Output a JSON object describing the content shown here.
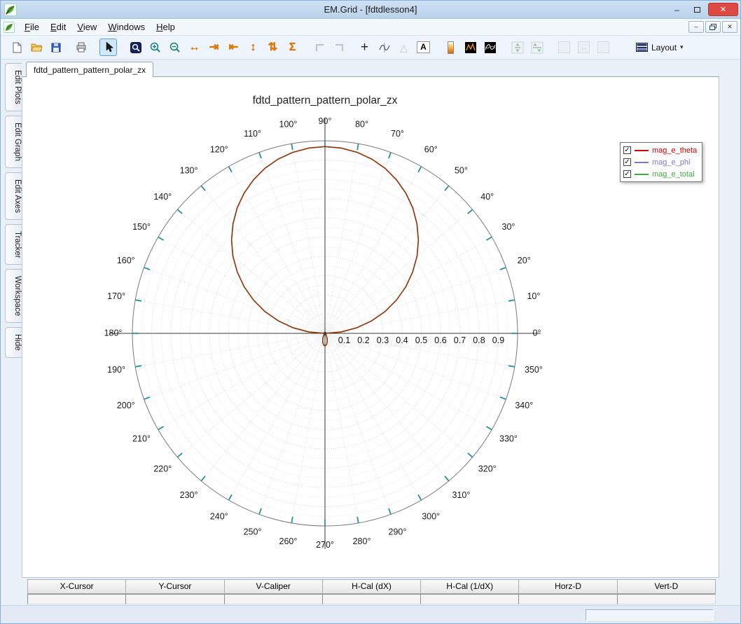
{
  "window": {
    "title": "EM.Grid - [fdtdlesson4]",
    "controls": {
      "minimize_glyph": "–",
      "close_glyph": "✕"
    }
  },
  "menu": {
    "items": [
      {
        "label": "File"
      },
      {
        "label": "Edit"
      },
      {
        "label": "View"
      },
      {
        "label": "Windows"
      },
      {
        "label": "Help"
      }
    ]
  },
  "toolbar": {
    "layout_label": "Layout",
    "glyphs": {
      "fit_h": "↔",
      "shift_r": "⇥",
      "shift_l": "⇤",
      "fit_v": "↕",
      "swap_v": "⇅",
      "autoscale": "Σ",
      "crosshair": "+",
      "triangle": "△",
      "text_tool": "A",
      "pane_h": "↔",
      "layout_caret": "▾"
    },
    "icons": [
      "new-file",
      "open-folder",
      "save",
      "print",
      "pointer",
      "zoom-region",
      "zoom-in",
      "zoom-out",
      "fit-horizontal",
      "shift-right",
      "shift-left",
      "fit-vertical",
      "swap-vertical",
      "autoscale-sum",
      "caliper-left",
      "caliper-right",
      "crosshair",
      "tracker-curve",
      "triangle-marker",
      "text-annotation",
      "colorbar",
      "spectrum-black-orange",
      "curves-black-white",
      "link-vertical-a",
      "link-vertical-b",
      "pane-a",
      "pane-horizontal",
      "pane-b",
      "layout-menu"
    ]
  },
  "sidebar": {
    "items": [
      {
        "label": "Edit Plots"
      },
      {
        "label": "Edit Graph"
      },
      {
        "label": "Edit Axes"
      },
      {
        "label": "Tracker"
      },
      {
        "label": "Workspace"
      },
      {
        "label": "Hide"
      }
    ]
  },
  "tabs": [
    {
      "label": "fdtd_pattern_pattern_polar_zx",
      "active": true
    }
  ],
  "chart_data": {
    "type": "polar",
    "title": "fdtd_pattern_pattern_polar_zx",
    "angle_unit": "deg",
    "angle_tick_step_deg": 10,
    "angle_label_suffix": "°",
    "angle_range": [
      0,
      360
    ],
    "r_axis": {
      "min": 0,
      "max": 1,
      "tick_step": 0.1,
      "grid_step": 0.05,
      "tick_labels": [
        "0.1",
        "0.2",
        "0.3",
        "0.4",
        "0.5",
        "0.6",
        "0.7",
        "0.8",
        "0.9"
      ]
    },
    "grid": true,
    "legend": {
      "position": "top-right",
      "check_glyph": "✓"
    },
    "series": [
      {
        "name": "mag_e_theta",
        "color": "#cc0000",
        "plot_color": "#8e3a10",
        "checked": true,
        "points": [
          [
            0,
            0
          ],
          [
            5,
            0.085
          ],
          [
            10,
            0.168
          ],
          [
            15,
            0.251
          ],
          [
            20,
            0.332
          ],
          [
            25,
            0.41
          ],
          [
            30,
            0.485
          ],
          [
            35,
            0.556
          ],
          [
            40,
            0.624
          ],
          [
            45,
            0.686
          ],
          [
            50,
            0.743
          ],
          [
            55,
            0.795
          ],
          [
            60,
            0.84
          ],
          [
            65,
            0.879
          ],
          [
            70,
            0.912
          ],
          [
            75,
            0.937
          ],
          [
            80,
            0.955
          ],
          [
            85,
            0.966
          ],
          [
            90,
            0.97
          ],
          [
            95,
            0.966
          ],
          [
            100,
            0.955
          ],
          [
            105,
            0.937
          ],
          [
            110,
            0.912
          ],
          [
            115,
            0.879
          ],
          [
            120,
            0.84
          ],
          [
            125,
            0.795
          ],
          [
            130,
            0.743
          ],
          [
            135,
            0.686
          ],
          [
            140,
            0.624
          ],
          [
            145,
            0.556
          ],
          [
            150,
            0.485
          ],
          [
            155,
            0.41
          ],
          [
            160,
            0.332
          ],
          [
            165,
            0.251
          ],
          [
            170,
            0.168
          ],
          [
            175,
            0.085
          ],
          [
            180,
            0
          ],
          [
            185,
            0.001
          ],
          [
            190,
            0.001
          ],
          [
            195,
            0.001
          ],
          [
            200,
            0.001
          ],
          [
            205,
            0.001
          ],
          [
            210,
            0.001
          ],
          [
            215,
            0.001
          ],
          [
            220,
            0.001
          ],
          [
            225,
            0.002
          ],
          [
            230,
            0.005
          ],
          [
            235,
            0.009
          ],
          [
            240,
            0.015
          ],
          [
            245,
            0.024
          ],
          [
            250,
            0.034
          ],
          [
            255,
            0.045
          ],
          [
            260,
            0.055
          ],
          [
            265,
            0.062
          ],
          [
            270,
            0.065
          ],
          [
            275,
            0.062
          ],
          [
            280,
            0.055
          ],
          [
            285,
            0.045
          ],
          [
            290,
            0.034
          ],
          [
            295,
            0.024
          ],
          [
            300,
            0.015
          ],
          [
            305,
            0.009
          ],
          [
            310,
            0.005
          ],
          [
            315,
            0.002
          ],
          [
            320,
            0.001
          ],
          [
            325,
            0.001
          ],
          [
            330,
            0.001
          ],
          [
            335,
            0.001
          ],
          [
            340,
            0.001
          ],
          [
            345,
            0.001
          ],
          [
            350,
            0.001
          ],
          [
            355,
            0.001
          ],
          [
            360,
            0
          ]
        ]
      },
      {
        "name": "mag_e_phi",
        "color": "#7a7ac8",
        "checked": true,
        "points": [
          [
            0,
            0.002
          ],
          [
            60,
            0.002
          ],
          [
            120,
            0.002
          ],
          [
            180,
            0.002
          ],
          [
            240,
            0.002
          ],
          [
            300,
            0.002
          ],
          [
            360,
            0.002
          ]
        ]
      },
      {
        "name": "mag_e_total",
        "color": "#3faa3f",
        "checked": true,
        "points": [
          [
            0,
            0.004
          ],
          [
            60,
            0.004
          ],
          [
            120,
            0.004
          ],
          [
            180,
            0.004
          ],
          [
            240,
            0.004
          ],
          [
            300,
            0.004
          ],
          [
            360,
            0.004
          ]
        ]
      }
    ]
  },
  "readout": {
    "columns": [
      "X-Cursor",
      "Y-Cursor",
      "V-Caliper",
      "H-Cal (dX)",
      "H-Cal (1/dX)",
      "Horz-D",
      "Vert-D"
    ],
    "values": [
      "",
      "",
      "",
      "",
      "",
      "",
      ""
    ]
  }
}
